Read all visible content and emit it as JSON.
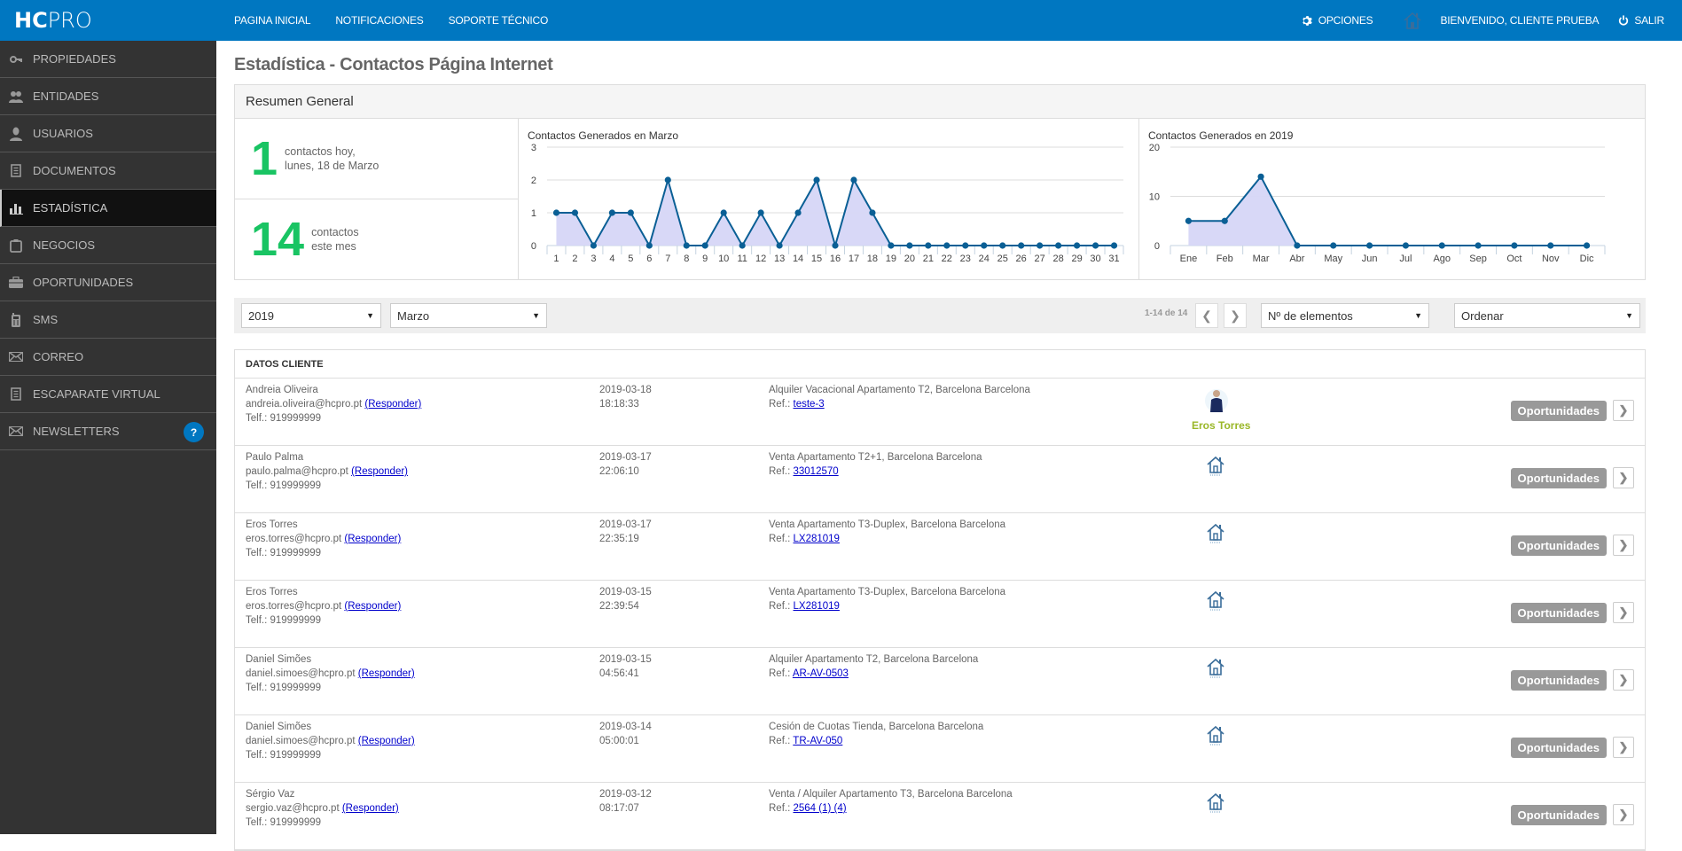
{
  "topbar": {
    "logo_a": "HC",
    "logo_b": "PRO",
    "nav": [
      "PAGINA INICIAL",
      "NOTIFICACIONES",
      "SOPORTE TÉCNICO"
    ],
    "options_label": "OPCIONES",
    "welcome_label": "BIENVENIDO, CLIENTE PRUEBA",
    "logout_label": "SALIR"
  },
  "sidebar": {
    "items": [
      {
        "label": "PROPIEDADES",
        "icon": "key-icon"
      },
      {
        "label": "ENTIDADES",
        "icon": "users-icon"
      },
      {
        "label": "USUARIOS",
        "icon": "user-icon"
      },
      {
        "label": "DOCUMENTOS",
        "icon": "document-icon"
      },
      {
        "label": "ESTADÍSTICA",
        "icon": "bar-chart-icon",
        "active": true
      },
      {
        "label": "NEGOCIOS",
        "icon": "clipboard-icon"
      },
      {
        "label": "OPORTUNIDADES",
        "icon": "briefcase-icon"
      },
      {
        "label": "SMS",
        "icon": "phone-icon"
      },
      {
        "label": "CORREO",
        "icon": "envelope-icon"
      },
      {
        "label": "ESCAPARATE VIRTUAL",
        "icon": "document-icon"
      },
      {
        "label": "NEWSLETTERS",
        "icon": "envelope-icon"
      }
    ],
    "help_label": "?"
  },
  "page": {
    "title": "Estadística - Contactos Página Internet",
    "summary_title": "Resumen General",
    "kpi_today_value": "1",
    "kpi_today_line1": "contactos hoy,",
    "kpi_today_line2": "lunes, 18 de Marzo",
    "kpi_month_value": "14",
    "kpi_month_line1": "contactos",
    "kpi_month_line2": "este mes"
  },
  "chart_data": [
    {
      "type": "area",
      "title": "Contactos Generados en Marzo",
      "categories": [
        "1",
        "2",
        "3",
        "4",
        "5",
        "6",
        "7",
        "8",
        "9",
        "10",
        "11",
        "12",
        "13",
        "14",
        "15",
        "16",
        "17",
        "18",
        "19",
        "20",
        "21",
        "22",
        "23",
        "24",
        "25",
        "26",
        "27",
        "28",
        "29",
        "30",
        "31"
      ],
      "values": [
        1,
        1,
        0,
        1,
        1,
        0,
        2,
        0,
        0,
        1,
        0,
        1,
        0,
        1,
        2,
        0,
        2,
        1,
        0,
        0,
        0,
        0,
        0,
        0,
        0,
        0,
        0,
        0,
        0,
        0,
        0
      ],
      "yticks": [
        0,
        1,
        2,
        3
      ],
      "ylim": [
        0,
        3
      ],
      "grid": true,
      "line_color": "#0a5f95",
      "fill_color": "#d6d6f7"
    },
    {
      "type": "area",
      "title": "Contactos Generados en 2019",
      "categories": [
        "Ene",
        "Feb",
        "Mar",
        "Abr",
        "May",
        "Jun",
        "Jul",
        "Ago",
        "Sep",
        "Oct",
        "Nov",
        "Dic"
      ],
      "values": [
        5,
        5,
        14,
        0,
        0,
        0,
        0,
        0,
        0,
        0,
        0,
        0
      ],
      "yticks": [
        0,
        10,
        20
      ],
      "ylim": [
        0,
        20
      ],
      "grid": true,
      "line_color": "#0a5f95",
      "fill_color": "#d6d6f7"
    }
  ],
  "filters": {
    "year": "2019",
    "month": "Marzo",
    "pagination": "1-14 de 14",
    "per_page": "Nº de elementos",
    "order": "Ordenar"
  },
  "table": {
    "header": "DATOS CLIENTE",
    "reply_label": "(Responder)",
    "ref_label": "Ref.:",
    "opp_label": "Oportunidades",
    "rows": [
      {
        "name": "Andreia Oliveira",
        "email": "andreia.oliveira@hcpro.pt",
        "phone": "Telf.: 919999999",
        "date": "2019-03-18",
        "time": "18:18:33",
        "property": "Alquiler Vacacional Apartamento T2, Barcelona Barcelona",
        "ref": "teste-3",
        "agent": "Eros Torres"
      },
      {
        "name": "Paulo Palma",
        "email": "paulo.palma@hcpro.pt",
        "phone": "Telf.: 919999999",
        "date": "2019-03-17",
        "time": "22:06:10",
        "property": "Venta Apartamento T2+1, Barcelona Barcelona",
        "ref": "33012570",
        "agent": ""
      },
      {
        "name": "Eros Torres",
        "email": "eros.torres@hcpro.pt",
        "phone": "Telf.: 919999999",
        "date": "2019-03-17",
        "time": "22:35:19",
        "property": "Venta Apartamento T3-Duplex, Barcelona Barcelona",
        "ref": "LX281019",
        "agent": ""
      },
      {
        "name": "Eros Torres",
        "email": "eros.torres@hcpro.pt",
        "phone": "Telf.: 919999999",
        "date": "2019-03-15",
        "time": "22:39:54",
        "property": "Venta Apartamento T3-Duplex, Barcelona Barcelona",
        "ref": "LX281019",
        "agent": ""
      },
      {
        "name": "Daniel Simões",
        "email": "daniel.simoes@hcpro.pt",
        "phone": "Telf.: 919999999",
        "date": "2019-03-15",
        "time": "04:56:41",
        "property": "Alquiler Apartamento T2, Barcelona Barcelona",
        "ref": "AR-AV-0503",
        "agent": ""
      },
      {
        "name": "Daniel Simões",
        "email": "daniel.simoes@hcpro.pt",
        "phone": "Telf.: 919999999",
        "date": "2019-03-14",
        "time": "05:00:01",
        "property": "Cesión de Cuotas Tienda, Barcelona Barcelona",
        "ref": "TR-AV-050",
        "agent": ""
      },
      {
        "name": "Sérgio Vaz",
        "email": "sergio.vaz@hcpro.pt",
        "phone": "Telf.: 919999999",
        "date": "2019-03-12",
        "time": "08:17:07",
        "property": "Venta / Alquiler Apartamento T3, Barcelona Barcelona",
        "ref": "2564 (1) (4)",
        "agent": ""
      }
    ]
  }
}
